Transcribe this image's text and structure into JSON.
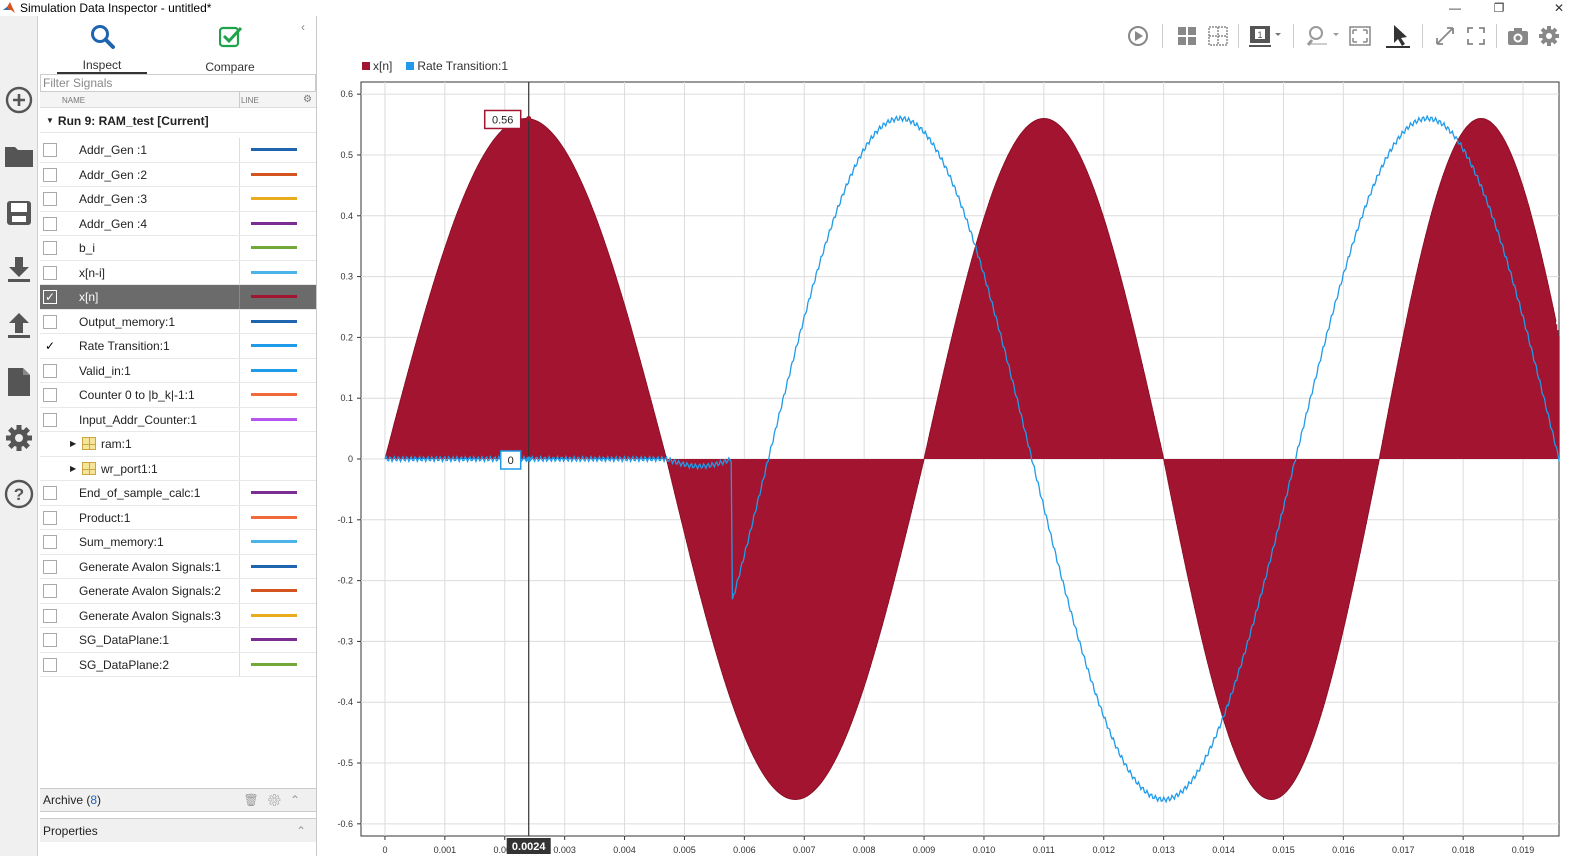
{
  "window": {
    "title": "Simulation Data Inspector - untitled*"
  },
  "tabs": {
    "inspect": "Inspect",
    "compare": "Compare"
  },
  "filter": {
    "placeholder": "Filter Signals"
  },
  "columns": {
    "name": "NAME",
    "line": "LINE"
  },
  "run": {
    "label": "Run 9: RAM_test [Current]"
  },
  "signals": [
    {
      "label": "Addr_Gen :1",
      "checked": false,
      "color": "#1f64ae"
    },
    {
      "label": "Addr_Gen :2",
      "checked": false,
      "color": "#d4541f"
    },
    {
      "label": "Addr_Gen :3",
      "checked": false,
      "color": "#e8ac1c"
    },
    {
      "label": "Addr_Gen :4",
      "checked": false,
      "color": "#7b2d92"
    },
    {
      "label": "b_i",
      "checked": false,
      "color": "#72a83a"
    },
    {
      "label": "x[n-i]",
      "checked": false,
      "color": "#4ab4e6"
    },
    {
      "label": "x[n]",
      "checked": true,
      "color": "#a2142f",
      "selected": true
    },
    {
      "label": "Output_memory:1",
      "checked": false,
      "color": "#1f64ae"
    },
    {
      "label": "Rate Transition:1",
      "checked": true,
      "color": "#1f9bea"
    },
    {
      "label": "Valid_in:1",
      "checked": false,
      "color": "#1f9bea"
    },
    {
      "label": "Counter 0 to |b_k|-1:1",
      "checked": false,
      "color": "#f06a3a"
    },
    {
      "label": "Input_Addr_Counter:1",
      "checked": false,
      "color": "#b456ef"
    },
    {
      "label": "ram:1",
      "group": true
    },
    {
      "label": "wr_port1:1",
      "group": true
    },
    {
      "label": "End_of_sample_calc:1",
      "checked": false,
      "color": "#7b2d92"
    },
    {
      "label": "Product:1",
      "checked": false,
      "color": "#f06a3a"
    },
    {
      "label": "Sum_memory:1",
      "checked": false,
      "color": "#4ab4e6"
    },
    {
      "label": "Generate Avalon Signals:1",
      "checked": false,
      "color": "#1f64ae"
    },
    {
      "label": "Generate Avalon Signals:2",
      "checked": false,
      "color": "#d4541f"
    },
    {
      "label": "Generate Avalon Signals:3",
      "checked": false,
      "color": "#e8ac1c"
    },
    {
      "label": "SG_DataPlane:1",
      "checked": false,
      "color": "#7b2d92"
    },
    {
      "label": "SG_DataPlane:2",
      "checked": false,
      "color": "#72a83a"
    }
  ],
  "archive": {
    "label": "Archive",
    "count": "8"
  },
  "properties": {
    "label": "Properties"
  },
  "icons": {
    "rail": [
      "add-icon",
      "folder-open-icon",
      "save-icon",
      "download-icon",
      "upload-icon",
      "report-icon",
      "settings-icon",
      "help-icon"
    ],
    "toolbar": [
      "play-icon",
      "layout-grid-icon",
      "subplot-icon",
      "visualization-icon",
      "zoom-icon",
      "fit-to-view-icon",
      "cursor-icon",
      "expand-icon",
      "fullscreen-icon",
      "snapshot-icon",
      "settings-icon"
    ]
  },
  "chart_data": {
    "type": "line",
    "legend": [
      "x[n]",
      "Rate Transition:1"
    ],
    "legend_placement": "top-left",
    "series": [
      {
        "name": "x[n]",
        "color": "#a2142f",
        "style": "stem",
        "description_points": {
          "x": [
            0,
            0.0024,
            0.0047,
            0.007,
            0.009,
            0.011,
            0.013,
            0.0148,
            0.0166,
            0.0183
          ],
          "y": [
            0,
            0.56,
            0,
            -0.56,
            0,
            0.56,
            0,
            -0.56,
            0,
            0.56
          ]
        }
      },
      {
        "name": "Rate Transition:1",
        "color": "#1f9bea",
        "style": "line",
        "x": [
          0,
          0.0047,
          0.0056,
          0.0085,
          0.0111,
          0.013,
          0.0145,
          0.0171,
          0.0198
        ],
        "y": [
          0,
          0,
          -0.01,
          0.56,
          0,
          -0.56,
          0,
          0.56,
          -0.28
        ]
      }
    ],
    "xlim": [
      -0.0004,
      0.0196
    ],
    "ylim": [
      -0.62,
      0.62
    ],
    "xticks": [
      "0",
      "0.001",
      "0.002",
      "0.003",
      "0.004",
      "0.005",
      "0.006",
      "0.007",
      "0.008",
      "0.009",
      "0.010",
      "0.011",
      "0.012",
      "0.013",
      "0.014",
      "0.015",
      "0.016",
      "0.017",
      "0.018",
      "0.019"
    ],
    "yticks": [
      "0.6",
      "0.5",
      "0.4",
      "0.3",
      "0.2",
      "0.1",
      "0",
      "-0.1",
      "-0.2",
      "-0.3",
      "-0.4",
      "-0.5",
      "-0.6"
    ],
    "grid": true,
    "cursor": {
      "x": 0.0024,
      "label": "0.0024",
      "value_labels": [
        "0.56",
        "0"
      ]
    }
  }
}
